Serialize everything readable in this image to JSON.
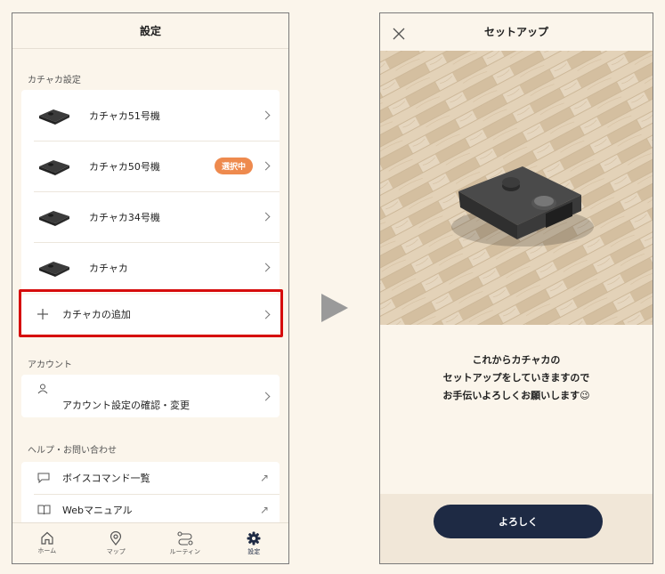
{
  "left": {
    "header_title": "設定",
    "section_robots": "カチャカ設定",
    "robots": [
      {
        "name": "カチャカ51号機"
      },
      {
        "name": "カチャカ50号機",
        "badge": "選択中"
      },
      {
        "name": "カチャカ34号機"
      },
      {
        "name": "カチャカ"
      }
    ],
    "add_robot": "カチャカの追加",
    "section_account": "アカウント",
    "account_settings": "アカウント設定の確認・変更",
    "section_help": "ヘルプ・お問い合わせ",
    "voice_commands": "ボイスコマンド一覧",
    "web_manual": "Webマニュアル",
    "tabs": [
      {
        "label": "ホーム",
        "icon": "home-icon"
      },
      {
        "label": "マップ",
        "icon": "map-pin-icon"
      },
      {
        "label": "ルーティン",
        "icon": "routine-icon"
      },
      {
        "label": "設定",
        "icon": "gear-icon"
      }
    ],
    "colors": {
      "badge": "#ee8a4e",
      "highlight": "#d60c0c"
    }
  },
  "right": {
    "header_title": "セットアップ",
    "message_line1": "これからカチャカの",
    "message_line2": "セットアップをしていきますので",
    "message_line3": "お手伝いよろしくお願いします😉",
    "button_label": "よろしく",
    "colors": {
      "button": "#1e2a44"
    }
  }
}
